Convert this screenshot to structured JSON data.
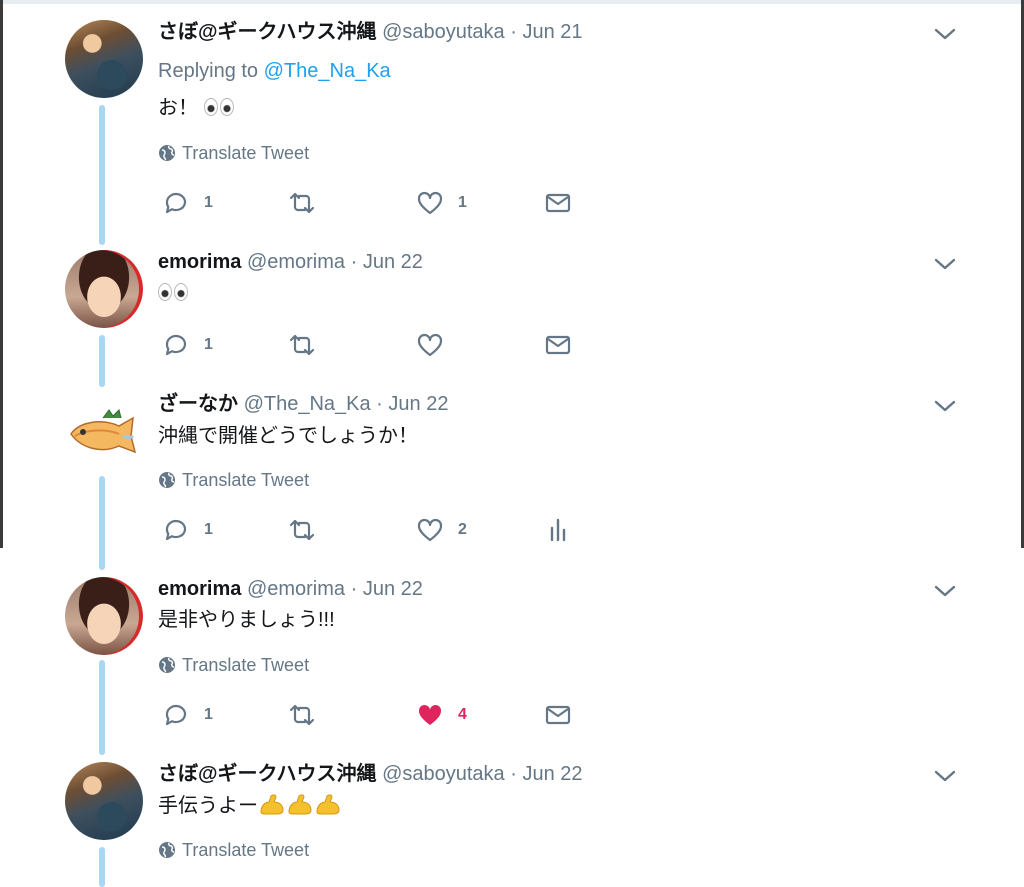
{
  "common": {
    "translate_label": "Translate Tweet",
    "replying_prefix": "Replying to",
    "dot": "·"
  },
  "tweets": [
    {
      "name": "さぼ@ギークハウス沖縄",
      "handle": "@saboyutaka",
      "date": "Jun 21",
      "replying_to": "@The_Na_Ka",
      "text": "お！",
      "emoji": [
        "eyes"
      ],
      "translate": true,
      "replies": "1",
      "retweets": "",
      "likes": "1",
      "liked": false,
      "last_action": "direct-message"
    },
    {
      "name": "emorima",
      "handle": "@emorima",
      "date": "Jun 22",
      "text": "",
      "emoji": [
        "eyes"
      ],
      "translate": false,
      "replies": "1",
      "retweets": "",
      "likes": "",
      "liked": false,
      "last_action": "direct-message"
    },
    {
      "name": "ざーなか",
      "handle": "@The_Na_Ka",
      "date": "Jun 22",
      "text": "沖縄で開催どうでしょうか！",
      "translate": true,
      "replies": "1",
      "retweets": "",
      "likes": "2",
      "liked": false,
      "last_action": "analytics"
    },
    {
      "name": "emorima",
      "handle": "@emorima",
      "date": "Jun 22",
      "text": "是非やりましょう!!!",
      "translate": true,
      "replies": "1",
      "retweets": "",
      "likes": "4",
      "liked": true,
      "last_action": "direct-message"
    },
    {
      "name": "さぼ@ギークハウス沖縄",
      "handle": "@saboyutaka",
      "date": "Jun 22",
      "text": "手伝うよー",
      "emoji": [
        "flexed-biceps",
        "flexed-biceps",
        "flexed-biceps"
      ],
      "translate": true
    }
  ],
  "colors": {
    "link": "#1da1f2",
    "muted": "#657786",
    "like": "#e0245e",
    "thread_line": "#a9d6f2"
  }
}
